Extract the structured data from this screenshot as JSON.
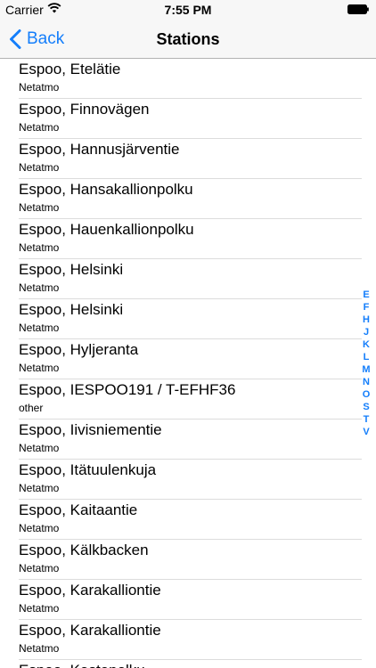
{
  "status_bar": {
    "carrier": "Carrier",
    "time": "7:55 PM"
  },
  "nav": {
    "back_label": "Back",
    "title": "Stations"
  },
  "stations": [
    {
      "name": "Espoo, Etelätie",
      "source": "Netatmo"
    },
    {
      "name": "Espoo, Finnovägen",
      "source": "Netatmo"
    },
    {
      "name": "Espoo, Hannusjärventie",
      "source": "Netatmo"
    },
    {
      "name": "Espoo, Hansakallionpolku",
      "source": "Netatmo"
    },
    {
      "name": "Espoo, Hauenkallionpolku",
      "source": "Netatmo"
    },
    {
      "name": "Espoo, Helsinki",
      "source": "Netatmo"
    },
    {
      "name": "Espoo, Helsinki",
      "source": "Netatmo"
    },
    {
      "name": "Espoo, Hyljeranta",
      "source": "Netatmo"
    },
    {
      "name": "Espoo, IESPOO191 / T-EFHF36",
      "source": "other"
    },
    {
      "name": "Espoo, Iivisniementie",
      "source": "Netatmo"
    },
    {
      "name": "Espoo, Itätuulenkuja",
      "source": "Netatmo"
    },
    {
      "name": "Espoo, Kaitaantie",
      "source": "Netatmo"
    },
    {
      "name": "Espoo, Kälkbacken",
      "source": "Netatmo"
    },
    {
      "name": "Espoo, Karakalliontie",
      "source": "Netatmo"
    },
    {
      "name": "Espoo, Karakalliontie",
      "source": "Netatmo"
    },
    {
      "name": "Espoo, Kastepolku",
      "source": ""
    }
  ],
  "section_index": [
    "E",
    "F",
    "H",
    "J",
    "K",
    "L",
    "M",
    "N",
    "O",
    "S",
    "T",
    "V"
  ],
  "colors": {
    "accent": "#147efb",
    "bar_background": "#f7f7f7"
  }
}
